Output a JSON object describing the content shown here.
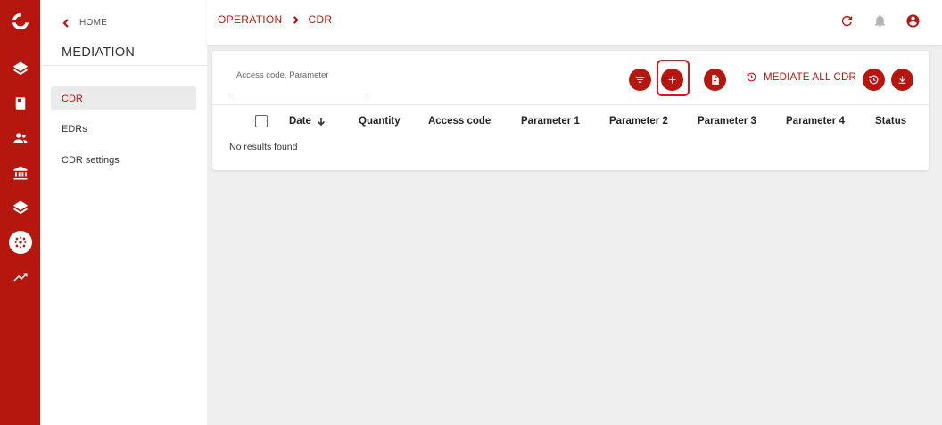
{
  "colors": {
    "brand": "#b5170f",
    "highlight": "#e01020"
  },
  "rail": {
    "icons": [
      "logo-icon",
      "layers-icon",
      "book-icon",
      "people-icon",
      "bank-icon",
      "layers-icon",
      "mediation-icon",
      "trending-up-icon"
    ],
    "active": "mediation-icon"
  },
  "sidebar": {
    "home_label": "HOME",
    "title": "MEDIATION",
    "items": [
      {
        "label": "CDR",
        "active": true
      },
      {
        "label": "EDRs",
        "active": false
      },
      {
        "label": "CDR settings",
        "active": false
      }
    ]
  },
  "header": {
    "breadcrumb": [
      "OPERATION",
      "CDR"
    ],
    "icons": [
      "refresh-icon",
      "bell-icon",
      "account-icon"
    ]
  },
  "toolbar": {
    "search_placeholder": "Access code, Parameter",
    "buttons": [
      "filter-icon",
      "add-icon",
      "import-file-icon",
      "history-icon",
      "download-icon"
    ],
    "mediate_label": "MEDIATE ALL CDR"
  },
  "table": {
    "columns": [
      "Date",
      "Quantity",
      "Access code",
      "Parameter 1",
      "Parameter 2",
      "Parameter 3",
      "Parameter 4",
      "Status"
    ],
    "sort_column": "Date",
    "empty_text": "No results found"
  }
}
